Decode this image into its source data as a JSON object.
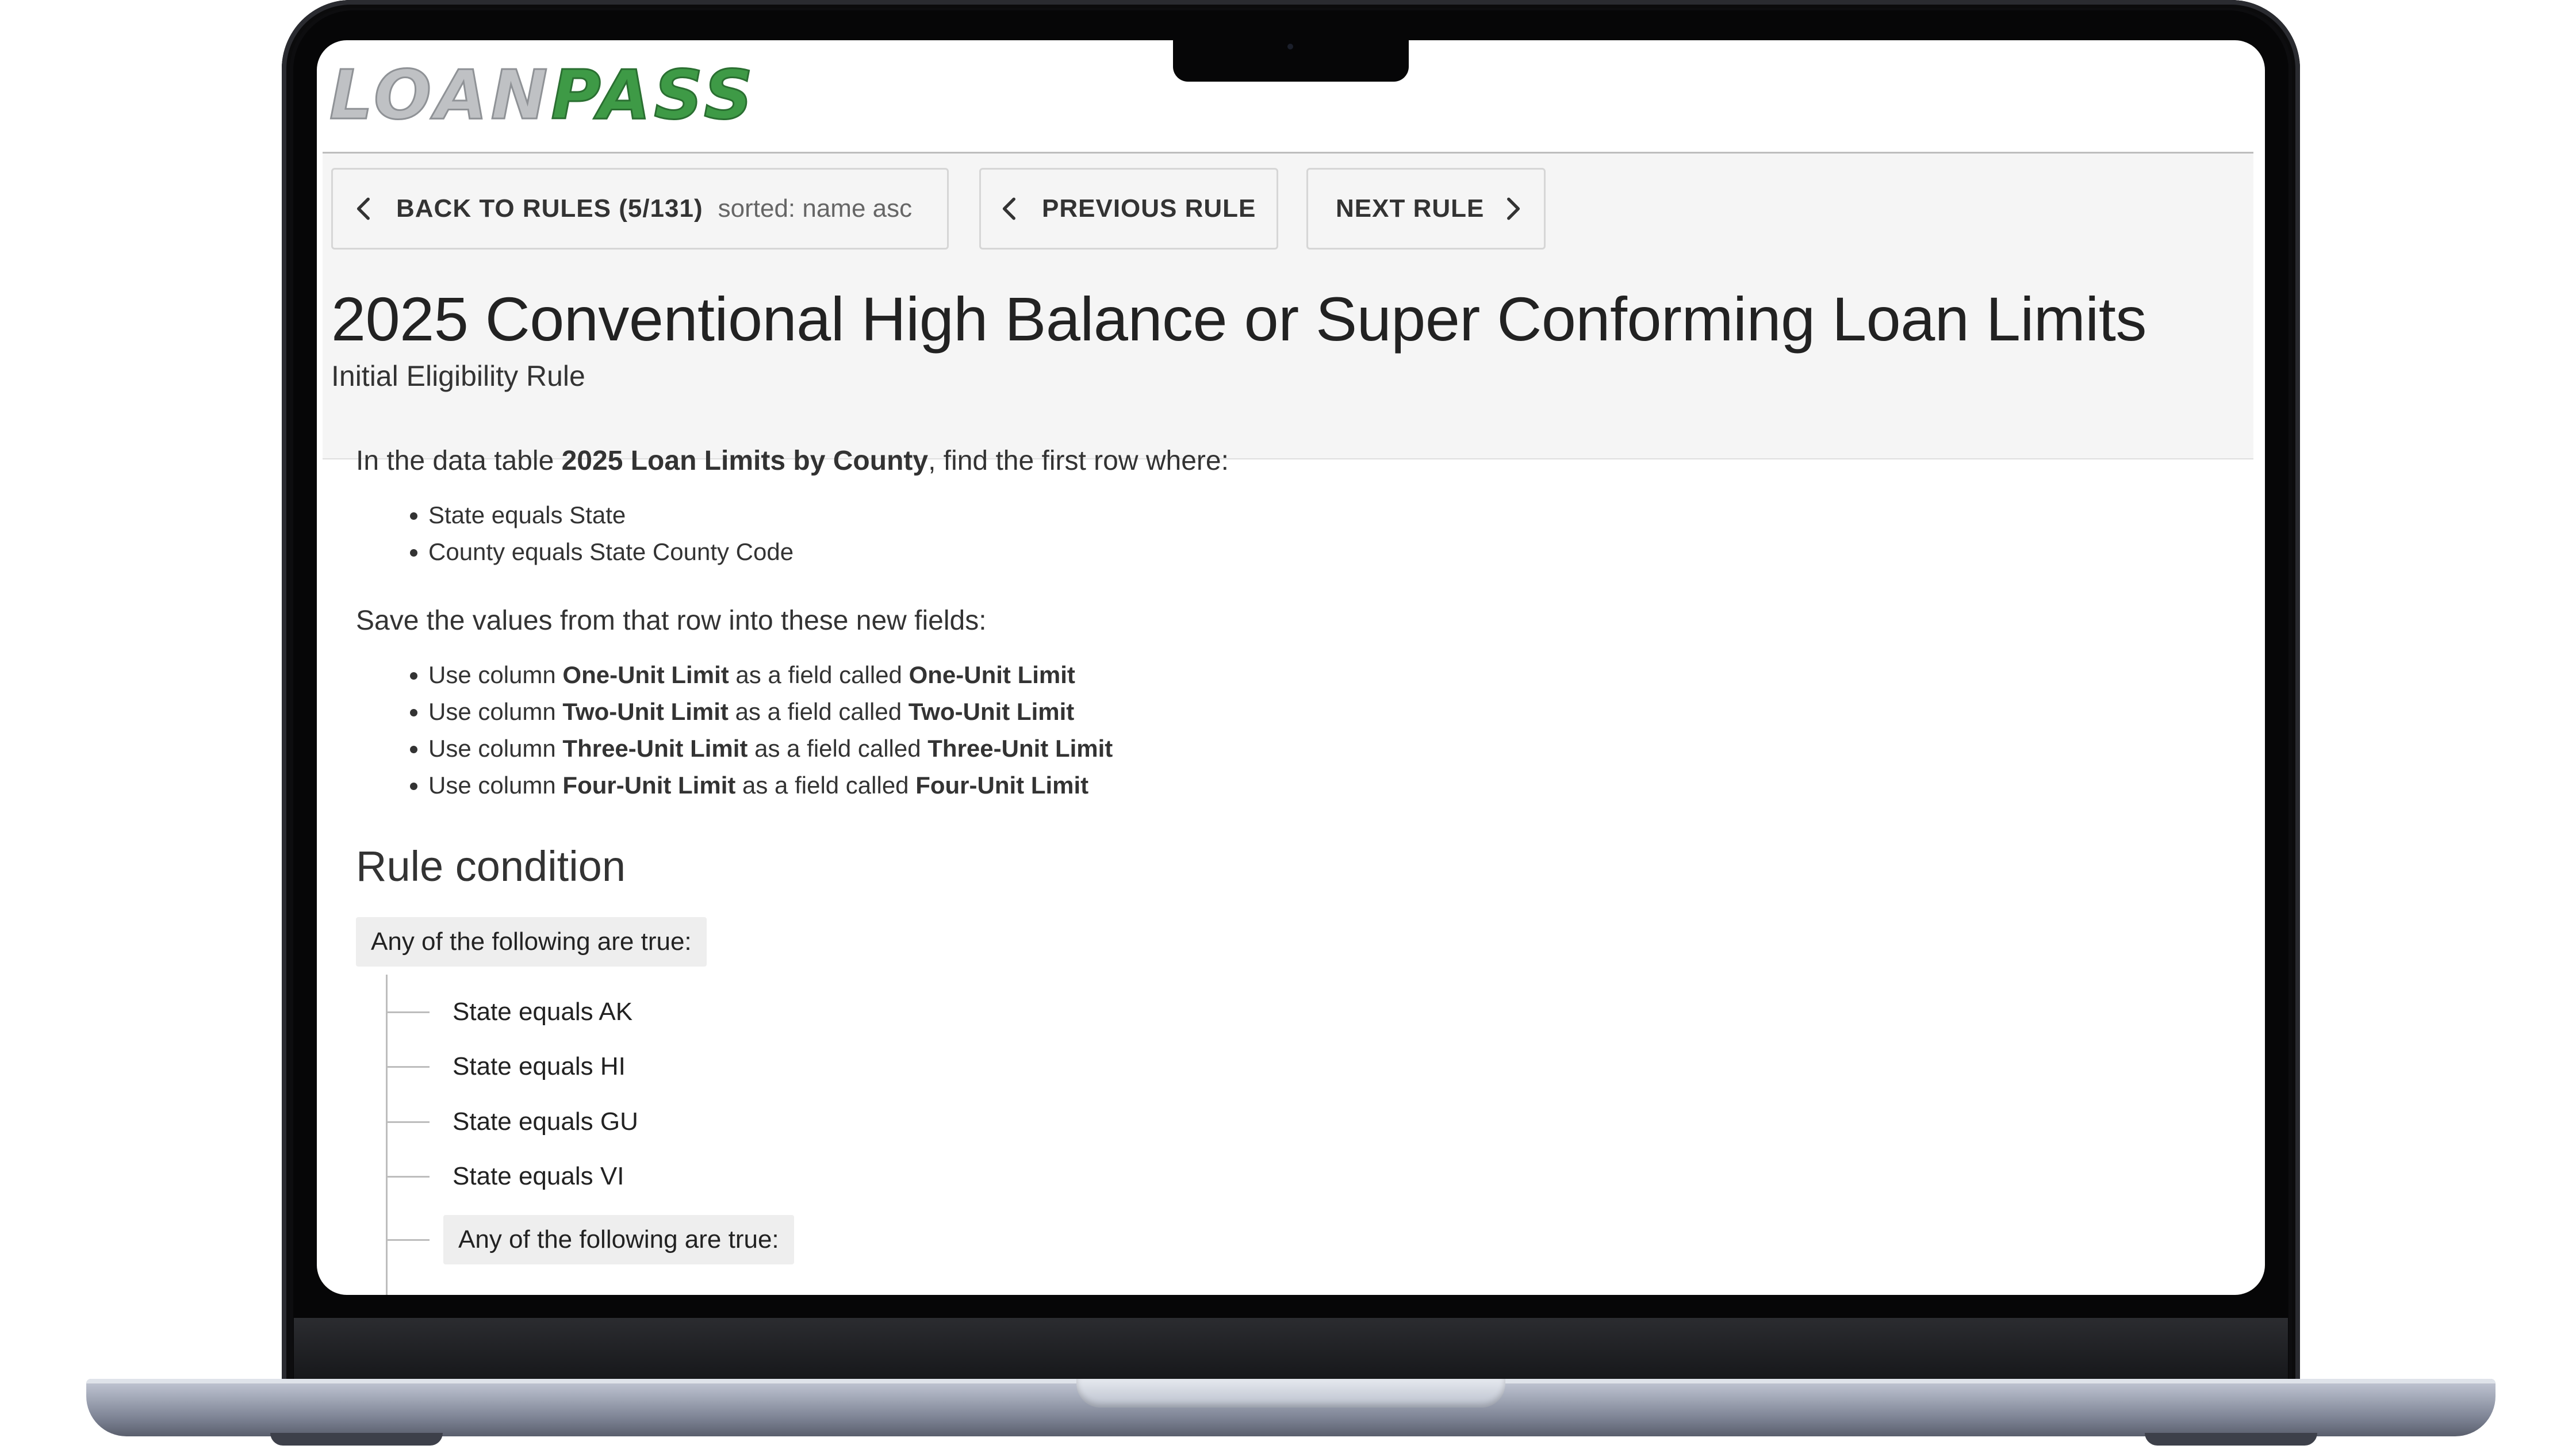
{
  "brand": {
    "logo_part1": "LOAN",
    "logo_part2": "PASS",
    "green": "#3e9a46"
  },
  "nav": {
    "back_label": "BACK TO RULES (5/131)",
    "back_sort": "sorted: name asc",
    "prev_label": "PREVIOUS RULE",
    "next_label": "NEXT RULE"
  },
  "rule": {
    "title": "2025 Conventional High Balance or Super Conforming Loan Limits",
    "subtitle": "Initial Eligibility Rule"
  },
  "lookup": {
    "intro_prefix": "In the data table ",
    "table_name": "2025 Loan Limits by County",
    "intro_suffix": ", find the first row where:",
    "conditions": [
      "State equals State",
      "County equals State County Code"
    ],
    "save_text": "Save the values from that row into these new fields:",
    "mappings": [
      {
        "column": "One-Unit Limit",
        "field": "One-Unit Limit"
      },
      {
        "column": "Two-Unit Limit",
        "field": "Two-Unit Limit"
      },
      {
        "column": "Three-Unit Limit",
        "field": "Three-Unit Limit"
      },
      {
        "column": "Four-Unit Limit",
        "field": "Four-Unit Limit"
      }
    ],
    "use_column": "Use column ",
    "as_field": " as a field called "
  },
  "condition": {
    "heading": "Rule condition",
    "group_label": "Any of the following are true:",
    "items": [
      "State equals AK",
      "State equals HI",
      "State equals GU",
      "State equals VI"
    ],
    "nested_group_label": "Any of the following are true:"
  }
}
